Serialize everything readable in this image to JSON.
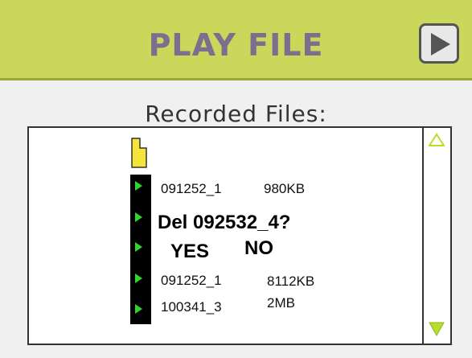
{
  "header": {
    "title": "PLAY FILE"
  },
  "subtitle": "Recorded Files:",
  "files": [
    {
      "name": "091252_1",
      "size": "980KB"
    },
    {
      "name": "091252_1",
      "size": "8112KB"
    },
    {
      "name": "100341_3",
      "size": "2MB"
    }
  ],
  "dialog": {
    "prompt": "Del 092532_4?",
    "yes": "YES",
    "no": "NO"
  },
  "colors": {
    "header": "#c9d75a",
    "arrow": "#2fd62f",
    "folder": "#f5e43a",
    "scroll_arrow": "#b6df2a"
  }
}
